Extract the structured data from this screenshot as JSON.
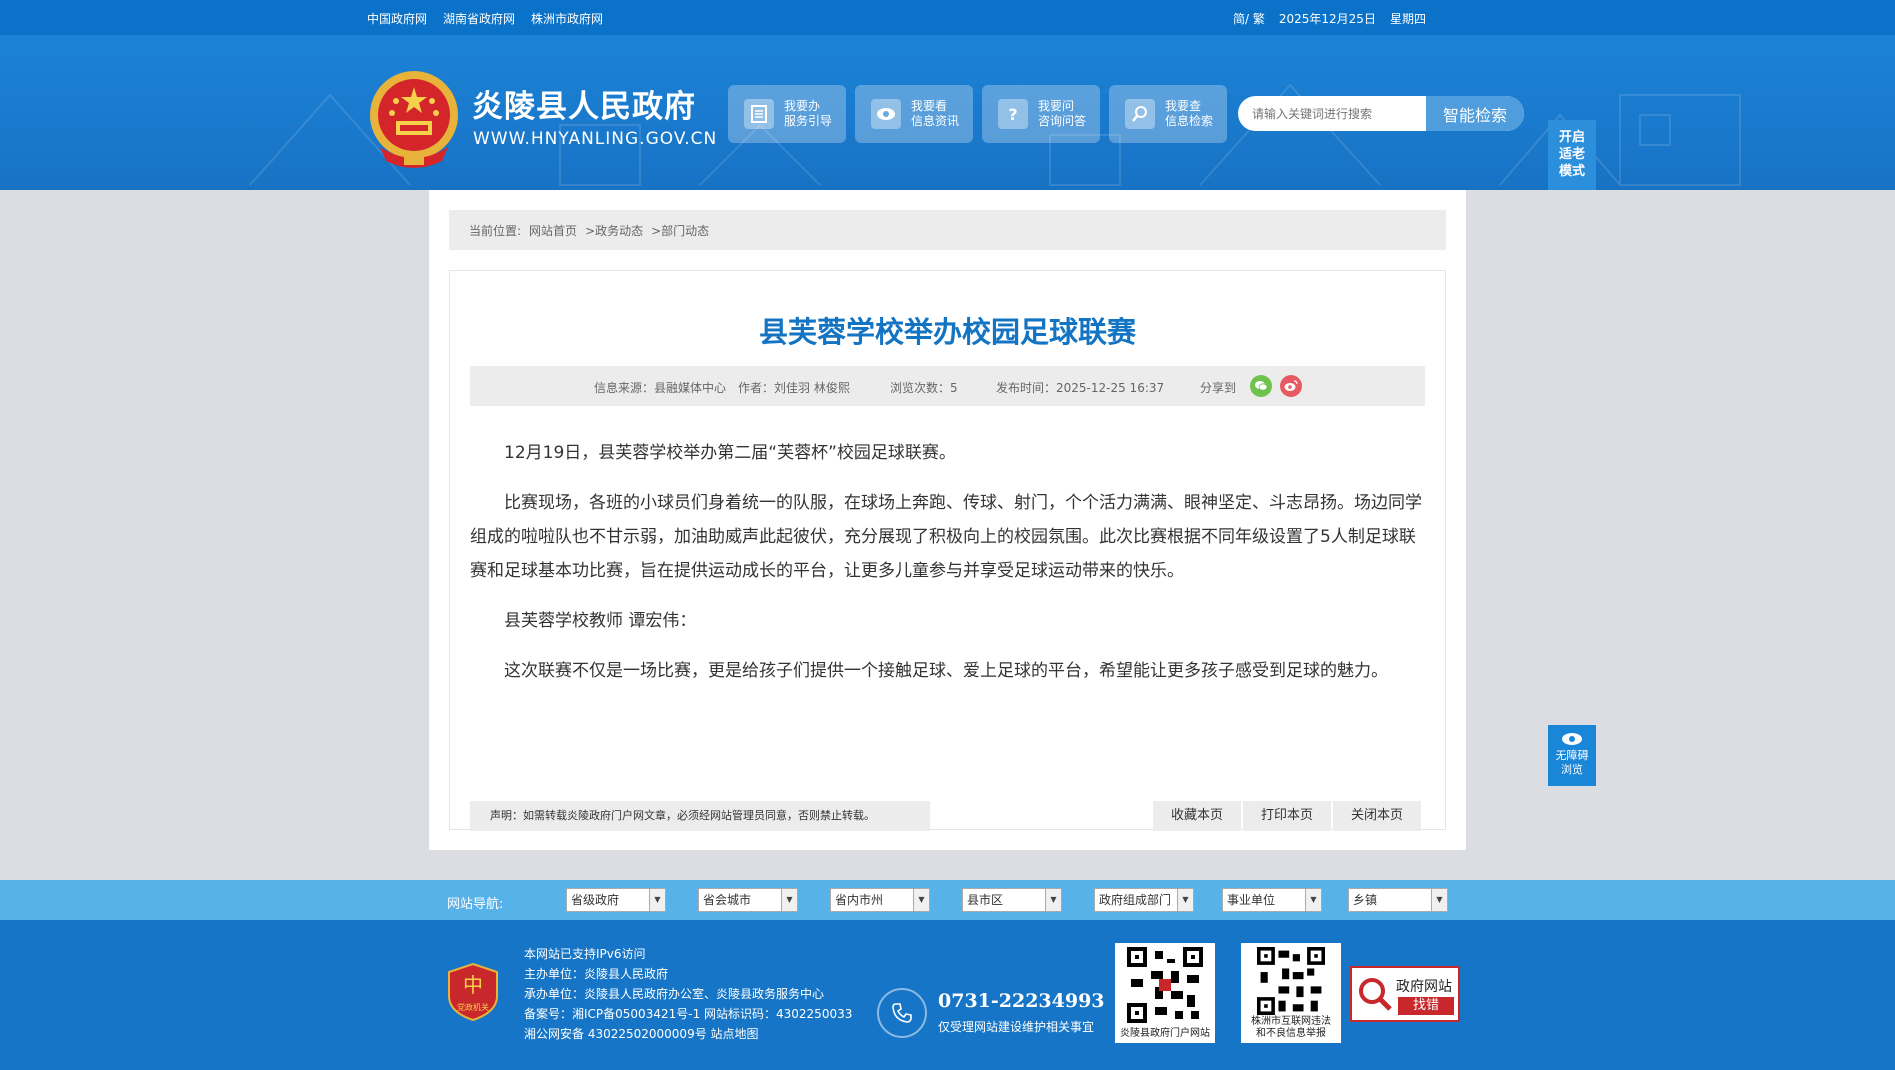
{
  "topbar": {
    "links": [
      "中国政府网",
      "湖南省政府网",
      "株洲市政府网"
    ],
    "lang": "简/ 繁",
    "date": "2025年12月25日",
    "weekday": "星期四"
  },
  "header": {
    "site_title": "炎陵县人民政府",
    "site_url": "WWW.HNYANLING.GOV.CN",
    "services": [
      {
        "line1": "我要办",
        "line2": "服务引导",
        "icon": "document-icon"
      },
      {
        "line1": "我要看",
        "line2": "信息资讯",
        "icon": "eye-icon"
      },
      {
        "line1": "我要问",
        "line2": "咨询问答",
        "icon": "question-icon"
      },
      {
        "line1": "我要查",
        "line2": "信息检索",
        "icon": "search-icon"
      }
    ],
    "search_placeholder": "请输入关键词进行搜索",
    "search_button": "智能检索",
    "care_mode": [
      "开启",
      "适老",
      "模式"
    ]
  },
  "breadcrumb": {
    "prefix": "当前位置:",
    "items": [
      "网站首页",
      ">政务动态",
      ">部门动态"
    ]
  },
  "article": {
    "title": "县芙蓉学校举办校园足球联赛",
    "meta": {
      "source": "信息来源：县融媒体中心",
      "author": "作者：刘佳羽 林俊熙",
      "views": "浏览次数：5",
      "published": "发布时间：2025-12-25 16:37",
      "share": "分享到"
    },
    "paragraphs": [
      "12月19日，县芙蓉学校举办第二届“芙蓉杯”校园足球联赛。",
      "比赛现场，各班的小球员们身着统一的队服，在球场上奔跑、传球、射门，个个活力满满、眼神坚定、斗志昂扬。场边同学组成的啦啦队也不甘示弱，加油助威声此起彼伏，充分展现了积极向上的校园氛围。此次比赛根据不同年级设置了5人制足球联赛和足球基本功比赛，旨在提供运动成长的平台，让更多儿童参与并享受足球运动带来的快乐。",
      "县芙蓉学校教师 谭宏伟：",
      "这次联赛不仅是一场比赛，更是给孩子们提供一个接触足球、爱上足球的平台，希望能让更多孩子感受到足球的魅力。"
    ],
    "notice": "声明：如需转载炎陵政府门户网文章，必须经网站管理员同意，否则禁止转载。",
    "actions": [
      "收藏本页",
      "打印本页",
      "关闭本页"
    ]
  },
  "accessibility": [
    "无障碍",
    "浏览"
  ],
  "sitenav": {
    "label": "网站导航:",
    "selects": [
      "省级政府",
      "省会城市",
      "省内市州",
      "县市区",
      "政府组成部门",
      "事业单位",
      "乡镇"
    ]
  },
  "footer": {
    "party_badge": "党政机关",
    "info": [
      "本网站已支持IPv6访问",
      "主办单位：炎陵县人民政府",
      "承办单位：炎陵县人民政府办公室、炎陵县政务服务中心",
      "备案号：湘ICP备05003421号-1 网站标识码：4302250033",
      "湘公网安备 43022502000009号 站点地图"
    ],
    "phone": "0731-22234993",
    "phone_note": "仅受理网站建设维护相关事宜",
    "qr1_caption": "炎陵县政府门户网站",
    "qr2_caption": [
      "株洲市互联网违法",
      "和不良信息举报"
    ],
    "jiucuo": {
      "line1": "政府网站",
      "line2": "找错"
    }
  },
  "colors": {
    "brand_blue": "#0a72c9",
    "title_blue": "#1474c4",
    "nav_blue": "#56b2e8",
    "footer_blue": "#1675c6"
  }
}
